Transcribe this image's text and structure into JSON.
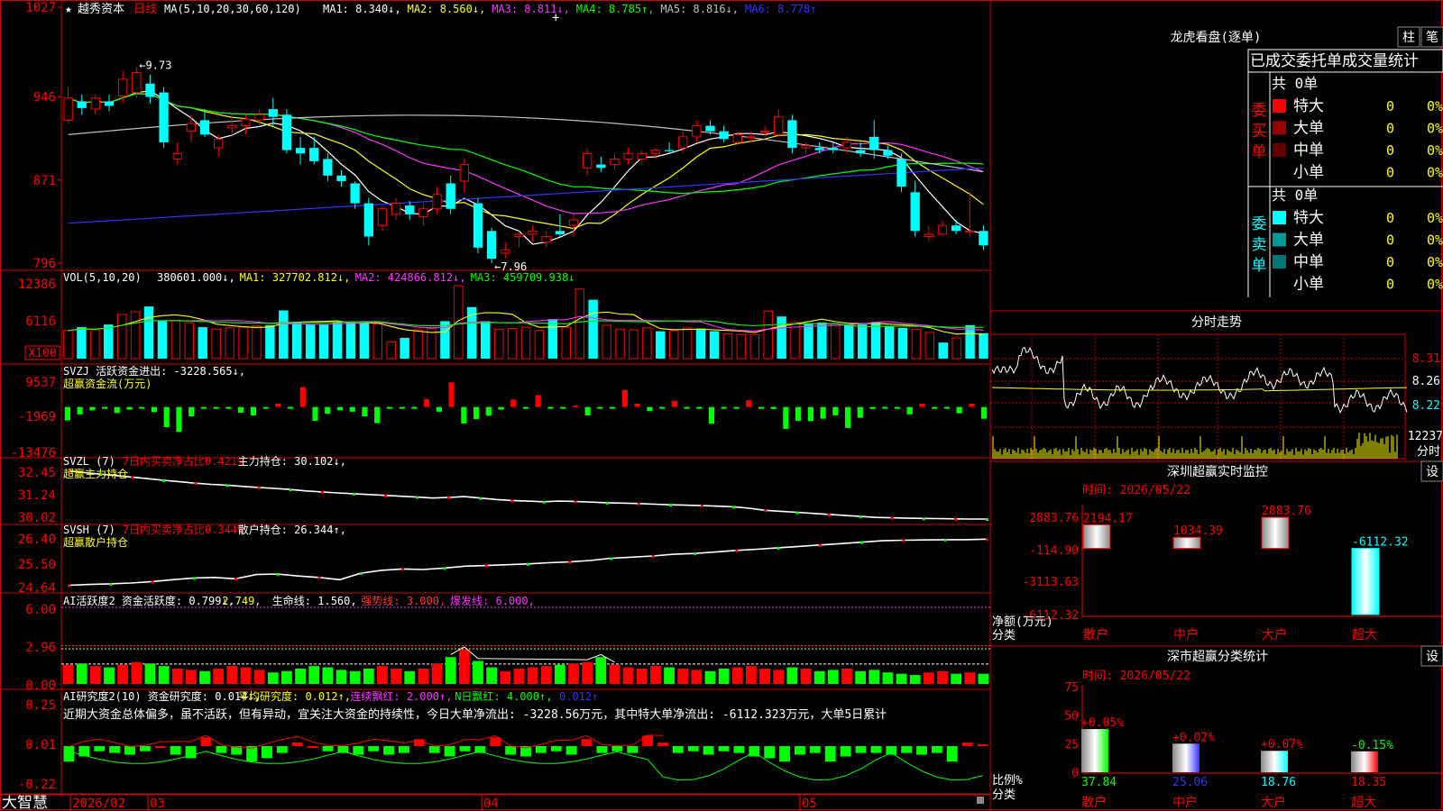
{
  "header": {
    "star": "★",
    "stock_name": "越秀资本",
    "period": "日线",
    "ma_title": "MA(5,10,20,30,60,120)",
    "ma_items": [
      {
        "text": "MA1: 8.340↓,",
        "color": "#ffffff"
      },
      {
        "text": "MA2: 8.560↓,",
        "color": "#ffff00"
      },
      {
        "text": "MA3: 8.811↓,",
        "color": "#ff33ff"
      },
      {
        "text": "MA4: 8.785↑,",
        "color": "#00ff00"
      },
      {
        "text": "MA5: 8.816↓,",
        "color": "#c0c0c0"
      },
      {
        "text": "MA6: 8.778↑",
        "color": "#3333ff"
      }
    ]
  },
  "price_axis": [
    "1027",
    "946",
    "871",
    "796"
  ],
  "price_markers": {
    "high": "9.73",
    "low": "7.96"
  },
  "vol_panel": {
    "title": "VOL(5,10,20)",
    "items": [
      {
        "text": "380601.000↓,",
        "color": "#ffffff"
      },
      {
        "text": "MA1: 327702.812↓,",
        "color": "#ffff00"
      },
      {
        "text": "MA2: 424866.812↓,",
        "color": "#ff33ff"
      },
      {
        "text": "MA3: 459709.938↓",
        "color": "#00ff00"
      }
    ],
    "axis": [
      "12386",
      "6116",
      "X100"
    ]
  },
  "svzj_panel": {
    "title": "SVZJ  活跃资金进出: -3228.565↓,",
    "subtitle": "超赢资金流(万元)",
    "axis": [
      "9537",
      "-1969",
      "-13476"
    ]
  },
  "svzl_panel": {
    "prefix": "SVZL (7) ",
    "highlight": "7日内买卖净占比0.421%",
    "suffix": " 主力持仓: 30.102↓,",
    "subtitle": "超赢主力持仓",
    "axis": [
      "32.45",
      "31.24",
      "30.02"
    ]
  },
  "svsh_panel": {
    "prefix": "SVSH (7) ",
    "highlight": "7日内买卖净占比0.344%",
    "suffix": " 散户持仓: 26.344↑,",
    "subtitle": "超赢散户持仓",
    "axis": [
      "26.40",
      "25.50",
      "24.64"
    ]
  },
  "ai_active_panel": {
    "items": [
      {
        "text": "AI活跃度2 资金活跃度: 0.799↓,",
        "color": "#ffffff"
      },
      {
        "text": "2.749,",
        "color": "#ffff00"
      },
      {
        "text": "生命线: 1.560,",
        "color": "#ffffff"
      },
      {
        "text": "强势线: 3.000,",
        "color": "#ff3333"
      },
      {
        "text": "爆发线: 6.000,",
        "color": "#ff33ff"
      }
    ],
    "axis": [
      "6.00",
      "2.96",
      "0.00"
    ]
  },
  "ai_research_panel": {
    "items": [
      {
        "text": "AI研究度2(10) 资金研究度: 0.014↓,",
        "color": "#ffffff"
      },
      {
        "text": "平均研究度: 0.012↑,",
        "color": "#ffff00"
      },
      {
        "text": "连续飘红: 2.000↑,",
        "color": "#ff33ff"
      },
      {
        "text": "N日飘红: 4.000↑,",
        "color": "#00ff00"
      },
      {
        "text": "0.012↑",
        "color": "#3333ff"
      }
    ],
    "comment": "近期大资金总体偏多，虽不活跃，但有异动，宜关注大资金的持续性，今日大单净流出: -3228.56万元，其中特大单净流出: -6112.323万元，大单5日累计",
    "axis": [
      "0.25",
      "0.01",
      "-0.22"
    ]
  },
  "date_axis": {
    "brand": "大智慧",
    "labels": [
      "2026/02",
      "03",
      "04",
      "05"
    ]
  },
  "dragon_tiger": {
    "title": "龙虎看盘(逐单)",
    "btn_bar": "柱",
    "btn_list": "笔",
    "subtitle": "已成交委托单成交量统计",
    "buy_side_label": "委买单",
    "sell_side_label": "委卖单",
    "buy_total": "共 0单",
    "sell_total": "共 0单",
    "buy_rows": [
      {
        "label": "特大",
        "count": "0",
        "pct": "0%",
        "color": "#ff0000"
      },
      {
        "label": "大单",
        "count": "0",
        "pct": "0%",
        "color": "#990000"
      },
      {
        "label": "中单",
        "count": "0",
        "pct": "0%",
        "color": "#660000"
      },
      {
        "label": "小单",
        "count": "0",
        "pct": "0%",
        "color": ""
      }
    ],
    "sell_rows": [
      {
        "label": "特大",
        "count": "0",
        "pct": "0%",
        "color": "#00ffff"
      },
      {
        "label": "大单",
        "count": "0",
        "pct": "0%",
        "color": "#009999"
      },
      {
        "label": "中单",
        "count": "0",
        "pct": "0%",
        "color": "#007777"
      },
      {
        "label": "小单",
        "count": "0",
        "pct": "0%",
        "color": ""
      }
    ]
  },
  "intraday": {
    "title": "分时走势",
    "axis": [
      "8.31",
      "8.26",
      "8.22"
    ],
    "vol_label": "12237",
    "vol_sub": "分时"
  },
  "sz_monitor": {
    "title": "深圳超赢实时监控",
    "setting": "设",
    "time": "时间: 2026/05/22",
    "axis": [
      "2883.76",
      "-114.90",
      "-3113.63",
      "-6112.32"
    ],
    "unit_label": "净额(万元)",
    "class_label": "分类",
    "categories": [
      "散户",
      "中户",
      "大户",
      "超大"
    ],
    "values": [
      2194.17,
      1034.39,
      2883.76,
      -6112.32
    ],
    "value_labels": [
      "2194.17",
      "1034.39",
      "2883.76",
      "-6112.32"
    ]
  },
  "sz_class": {
    "title": "深市超赢分类统计",
    "setting": "设",
    "time": "时间: 2026/05/22",
    "axis": [
      "75",
      "50",
      "25",
      "0"
    ],
    "unit_label": "比例%",
    "class_label": "分类",
    "categories": [
      "散户",
      "中户",
      "大户",
      "超大"
    ],
    "ratios": [
      37.84,
      25.06,
      18.76,
      18.35
    ],
    "ratio_labels": [
      "37.84",
      "25.06",
      "18.76",
      "18.35"
    ],
    "changes": [
      "+0.05%",
      "+0.02%",
      "+0.07%",
      "-0.15%"
    ],
    "colors": [
      "#00ff00",
      "#3333ff",
      "#00ffff",
      "#ff0000"
    ]
  },
  "chart_data": [
    {
      "type": "candlestick",
      "title": "越秀资本 日线",
      "ylim": [
        7.96,
        10.27
      ],
      "x": [
        "2026/02",
        "03",
        "04",
        "05"
      ],
      "candles": [
        {
          "o": 9.25,
          "h": 9.55,
          "l": 9.22,
          "c": 9.45
        },
        {
          "o": 9.42,
          "h": 9.48,
          "l": 9.3,
          "c": 9.36
        },
        {
          "o": 9.35,
          "h": 9.48,
          "l": 9.3,
          "c": 9.45
        },
        {
          "o": 9.42,
          "h": 9.48,
          "l": 9.33,
          "c": 9.38
        },
        {
          "o": 9.47,
          "h": 9.7,
          "l": 9.4,
          "c": 9.62
        },
        {
          "o": 9.5,
          "h": 9.73,
          "l": 9.45,
          "c": 9.68
        },
        {
          "o": 9.58,
          "h": 9.66,
          "l": 9.4,
          "c": 9.46
        },
        {
          "o": 9.5,
          "h": 9.55,
          "l": 9.0,
          "c": 9.05
        },
        {
          "o": 8.9,
          "h": 9.05,
          "l": 8.85,
          "c": 8.95
        },
        {
          "o": 9.15,
          "h": 9.3,
          "l": 9.05,
          "c": 9.22
        },
        {
          "o": 9.25,
          "h": 9.35,
          "l": 9.1,
          "c": 9.12
        },
        {
          "o": 9.0,
          "h": 9.12,
          "l": 8.92,
          "c": 9.08
        },
        {
          "o": 9.18,
          "h": 9.3,
          "l": 9.1,
          "c": 9.2
        },
        {
          "o": 9.2,
          "h": 9.3,
          "l": 9.12,
          "c": 9.26
        },
        {
          "o": 9.25,
          "h": 9.35,
          "l": 9.2,
          "c": 9.3
        },
        {
          "o": 9.35,
          "h": 9.45,
          "l": 9.2,
          "c": 9.28
        },
        {
          "o": 9.3,
          "h": 9.35,
          "l": 8.95,
          "c": 8.98
        },
        {
          "o": 9.0,
          "h": 9.1,
          "l": 8.85,
          "c": 8.95
        },
        {
          "o": 9.0,
          "h": 9.1,
          "l": 8.85,
          "c": 8.88
        },
        {
          "o": 8.9,
          "h": 8.95,
          "l": 8.7,
          "c": 8.75
        },
        {
          "o": 8.75,
          "h": 8.8,
          "l": 8.65,
          "c": 8.7
        },
        {
          "o": 8.68,
          "h": 8.7,
          "l": 8.45,
          "c": 8.5
        },
        {
          "o": 8.5,
          "h": 8.55,
          "l": 8.12,
          "c": 8.2
        },
        {
          "o": 8.3,
          "h": 8.48,
          "l": 8.25,
          "c": 8.45
        },
        {
          "o": 8.4,
          "h": 8.55,
          "l": 8.35,
          "c": 8.5
        },
        {
          "o": 8.48,
          "h": 8.52,
          "l": 8.35,
          "c": 8.4
        },
        {
          "o": 8.38,
          "h": 8.5,
          "l": 8.3,
          "c": 8.45
        },
        {
          "o": 8.45,
          "h": 8.65,
          "l": 8.4,
          "c": 8.58
        },
        {
          "o": 8.68,
          "h": 8.75,
          "l": 8.4,
          "c": 8.45
        },
        {
          "o": 8.7,
          "h": 8.9,
          "l": 8.6,
          "c": 8.85
        },
        {
          "o": 8.5,
          "h": 8.55,
          "l": 8.05,
          "c": 8.1
        },
        {
          "o": 8.25,
          "h": 8.28,
          "l": 7.96,
          "c": 8.0
        },
        {
          "o": 8.05,
          "h": 8.15,
          "l": 8.0,
          "c": 8.08
        },
        {
          "o": 8.2,
          "h": 8.25,
          "l": 8.1,
          "c": 8.22
        },
        {
          "o": 8.22,
          "h": 8.3,
          "l": 8.15,
          "c": 8.25
        },
        {
          "o": 8.15,
          "h": 8.25,
          "l": 8.1,
          "c": 8.2
        },
        {
          "o": 8.25,
          "h": 8.4,
          "l": 8.2,
          "c": 8.22
        },
        {
          "o": 8.3,
          "h": 8.4,
          "l": 8.2,
          "c": 8.35
        },
        {
          "o": 8.82,
          "h": 9.0,
          "l": 8.75,
          "c": 8.95
        },
        {
          "o": 8.85,
          "h": 8.92,
          "l": 8.78,
          "c": 8.82
        },
        {
          "o": 8.85,
          "h": 8.95,
          "l": 8.8,
          "c": 8.9
        },
        {
          "o": 8.9,
          "h": 9.0,
          "l": 8.85,
          "c": 8.95
        },
        {
          "o": 8.9,
          "h": 8.98,
          "l": 8.85,
          "c": 8.95
        },
        {
          "o": 8.95,
          "h": 9.0,
          "l": 8.9,
          "c": 8.98
        },
        {
          "o": 8.98,
          "h": 9.05,
          "l": 8.95,
          "c": 8.97
        },
        {
          "o": 9.0,
          "h": 9.15,
          "l": 8.95,
          "c": 9.1
        },
        {
          "o": 9.1,
          "h": 9.25,
          "l": 9.05,
          "c": 9.2
        },
        {
          "o": 9.2,
          "h": 9.25,
          "l": 9.12,
          "c": 9.15
        },
        {
          "o": 9.15,
          "h": 9.2,
          "l": 9.05,
          "c": 9.08
        },
        {
          "o": 9.05,
          "h": 9.15,
          "l": 9.02,
          "c": 9.12
        },
        {
          "o": 9.1,
          "h": 9.15,
          "l": 9.05,
          "c": 9.1
        },
        {
          "o": 9.15,
          "h": 9.2,
          "l": 9.1,
          "c": 9.15
        },
        {
          "o": 9.12,
          "h": 9.35,
          "l": 9.1,
          "c": 9.28
        },
        {
          "o": 9.25,
          "h": 9.3,
          "l": 8.95,
          "c": 9.0
        },
        {
          "o": 9.0,
          "h": 9.05,
          "l": 8.95,
          "c": 9.02
        },
        {
          "o": 9.0,
          "h": 9.05,
          "l": 8.95,
          "c": 8.98
        },
        {
          "o": 9.0,
          "h": 9.05,
          "l": 8.95,
          "c": 8.98
        },
        {
          "o": 9.0,
          "h": 9.1,
          "l": 8.95,
          "c": 9.05
        },
        {
          "o": 8.98,
          "h": 9.05,
          "l": 8.92,
          "c": 8.95
        },
        {
          "o": 9.1,
          "h": 9.25,
          "l": 8.9,
          "c": 8.98
        },
        {
          "o": 8.98,
          "h": 9.02,
          "l": 8.9,
          "c": 8.93
        },
        {
          "o": 8.9,
          "h": 8.95,
          "l": 8.6,
          "c": 8.65
        },
        {
          "o": 8.6,
          "h": 8.7,
          "l": 8.2,
          "c": 8.25
        },
        {
          "o": 8.2,
          "h": 8.3,
          "l": 8.15,
          "c": 8.22
        },
        {
          "o": 8.22,
          "h": 8.35,
          "l": 8.2,
          "c": 8.3
        },
        {
          "o": 8.3,
          "h": 8.35,
          "l": 8.22,
          "c": 8.25
        },
        {
          "o": 8.25,
          "h": 8.6,
          "l": 8.2,
          "c": 8.25
        },
        {
          "o": 8.25,
          "h": 8.3,
          "l": 8.08,
          "c": 8.12
        }
      ]
    },
    {
      "type": "bar",
      "title": "VOL(5,10,20)",
      "ylim": [
        0,
        12386
      ],
      "values": [
        4200,
        4700,
        4300,
        5100,
        6600,
        7000,
        7800,
        5600,
        5700,
        5400,
        4700,
        4400,
        4600,
        4700,
        4900,
        5000,
        7200,
        5400,
        5100,
        5100,
        5400,
        5500,
        5400,
        5200,
        2500,
        3100,
        4300,
        4500,
        5600,
        10900,
        7700,
        5600,
        4400,
        4500,
        4700,
        4200,
        5900,
        4700,
        10400,
        8800,
        5000,
        4400,
        4300,
        4600,
        4100,
        4200,
        4600,
        4500,
        4100,
        3700,
        3600,
        3600,
        7100,
        6300,
        5400,
        5300,
        5400,
        5200,
        5100,
        5100,
        5500,
        4900,
        4600,
        4400,
        3900,
        2400,
        3100,
        5000,
        3800
      ]
    },
    {
      "type": "bar",
      "title": "SVZJ 活跃资金进出",
      "ylim": [
        -13476,
        9537
      ],
      "values": [
        -4000,
        -2200,
        -1000,
        -300,
        -1800,
        -800,
        -400,
        -1500,
        -6000,
        -7400,
        -2800,
        -500,
        -200,
        -400,
        -1700,
        -2500,
        -300,
        1000,
        -200,
        5900,
        -4100,
        -2000,
        -1000,
        -1400,
        -2800,
        -4800,
        -200,
        -400,
        -400,
        2300,
        -1400,
        7300,
        -4900,
        -3600,
        -2600,
        -800,
        2200,
        -500,
        3500,
        -500,
        -200,
        400,
        -2500,
        -400,
        -200,
        5000,
        1000,
        -1200,
        -500,
        1800,
        -500,
        -500,
        -5000,
        -400,
        -500,
        2000,
        -500,
        -600,
        -6500,
        -4100,
        -4200,
        -3500,
        -2500,
        -6200,
        -3200,
        -600,
        -400,
        -300,
        -2200,
        1000,
        -500,
        -200,
        -1900,
        1000,
        -3500
      ]
    },
    {
      "type": "line",
      "title": "SVZL 主力持仓",
      "ylim": [
        30.02,
        32.45
      ],
      "values": [
        32.38,
        32.3,
        32.22,
        32.15,
        32.08,
        32.0,
        31.92,
        31.85,
        31.78,
        31.72,
        31.68,
        31.62,
        31.57,
        31.52,
        31.47,
        31.4,
        31.35,
        31.3,
        31.26,
        31.22,
        31.18,
        31.14,
        31.1,
        31.05,
        31.08,
        31.12,
        31.05,
        30.98,
        30.93,
        30.9,
        30.87,
        30.9,
        30.88,
        30.85,
        30.82,
        30.8,
        30.78,
        30.75,
        30.72,
        30.7,
        30.68,
        30.65,
        30.62,
        30.55,
        30.45,
        30.4,
        30.35,
        30.3,
        30.25,
        30.2,
        30.15,
        30.1,
        30.08,
        30.06,
        30.05,
        30.04,
        30.03,
        30.02,
        30.02
      ]
    },
    {
      "type": "line",
      "title": "SVSH 散户持仓",
      "ylim": [
        24.64,
        26.4
      ],
      "values": [
        24.72,
        24.75,
        24.77,
        24.8,
        24.85,
        24.92,
        24.98,
        25.0,
        24.95,
        25.1,
        25.12,
        25.05,
        25.0,
        24.92,
        25.15,
        25.25,
        25.3,
        25.28,
        25.33,
        25.4,
        25.42,
        25.45,
        25.48,
        25.52,
        25.55,
        25.6,
        25.68,
        25.72,
        25.76,
        25.82,
        25.85,
        25.9,
        25.96,
        26.0,
        26.05,
        26.1,
        26.15,
        26.2,
        26.25,
        26.3,
        26.32,
        26.33,
        26.34,
        26.34,
        26.36
      ]
    },
    {
      "type": "bar",
      "title": "AI活跃度2",
      "ylim": [
        0,
        6.0
      ],
      "values": [
        1.5,
        1.6,
        1.4,
        1.3,
        1.5,
        1.7,
        1.6,
        1.4,
        1.2,
        1.1,
        1.0,
        1.2,
        1.4,
        1.3,
        1.1,
        0.9,
        1.0,
        1.2,
        1.4,
        1.3,
        1.1,
        1.0,
        1.2,
        1.4,
        1.2,
        1.0,
        1.2,
        1.6,
        2.1,
        2.7,
        1.8,
        1.3,
        1.0,
        1.2,
        1.3,
        1.4,
        1.5,
        1.6,
        1.7,
        2.1,
        1.5,
        1.3,
        1.2,
        1.4,
        1.3,
        1.2,
        1.1,
        1.0,
        1.2,
        1.3,
        1.4,
        1.2,
        1.1,
        1.3,
        1.2,
        1.0,
        1.1,
        1.2,
        1.0,
        1.1,
        0.9,
        0.8,
        0.7,
        0.9,
        1.0,
        0.8,
        0.9,
        0.8
      ]
    },
    {
      "type": "bar",
      "title": "AI研究度2(10)",
      "ylim": [
        -0.22,
        0.25
      ],
      "values": [
        -0.08,
        -0.05,
        -0.02,
        -0.03,
        -0.04,
        -0.02,
        0.0,
        -0.04,
        -0.06,
        0.06,
        -0.03,
        -0.04,
        -0.08,
        -0.06,
        -0.03,
        0.03,
        0.0,
        -0.02,
        -0.03,
        -0.04,
        -0.02,
        -0.04,
        -0.03,
        0.05,
        -0.03,
        -0.05,
        -0.02,
        -0.03,
        0.06,
        -0.04,
        -0.05,
        -0.03,
        -0.02,
        -0.04,
        0.05,
        -0.03,
        -0.02,
        -0.03,
        0.07,
        0.03,
        -0.03,
        -0.02,
        -0.04,
        -0.02,
        -0.03,
        -0.05,
        -0.06,
        -0.08,
        -0.04,
        -0.03,
        -0.08,
        -0.05,
        -0.03,
        -0.03,
        -0.04,
        -0.03,
        -0.04,
        -0.03,
        -0.08,
        0.03,
        0.02
      ]
    }
  ]
}
